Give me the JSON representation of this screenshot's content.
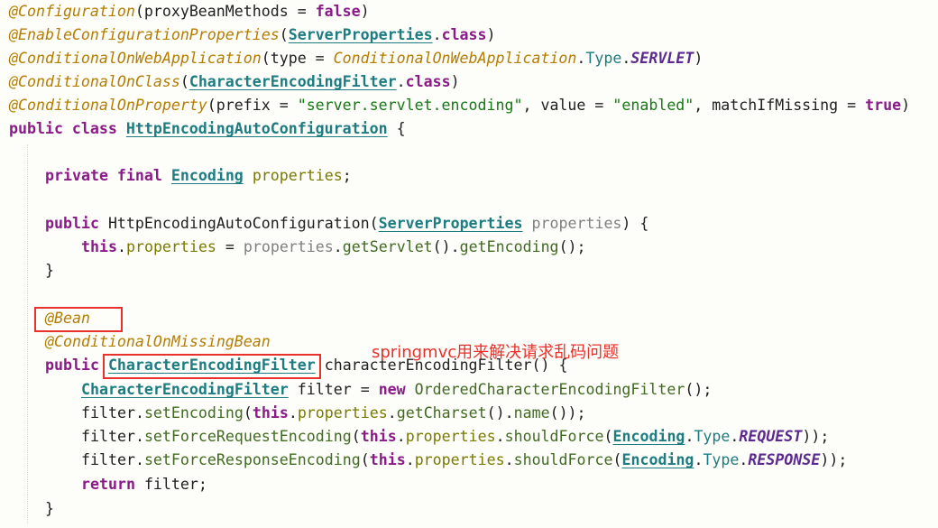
{
  "code": {
    "l1": [
      "@Configuration",
      "(proxyBeanMethods = ",
      "false",
      ")"
    ],
    "l2": [
      "@EnableConfigurationProperties",
      "(",
      "ServerProperties",
      ".",
      "class",
      ")"
    ],
    "l3": [
      "@ConditionalOnWebApplication",
      "(type = ",
      "ConditionalOnWebApplication",
      ".",
      "Type",
      ".",
      "SERVLET",
      ")"
    ],
    "l4": [
      "@ConditionalOnClass",
      "(",
      "CharacterEncodingFilter",
      ".",
      "class",
      ")"
    ],
    "l5": [
      "@ConditionalOnProperty",
      "(prefix = ",
      "\"server.servlet.encoding\"",
      ", value = ",
      "\"enabled\"",
      ", matchIfMissing = ",
      "true",
      ")"
    ],
    "l6": [
      "public class ",
      "HttpEncodingAutoConfiguration",
      " {"
    ],
    "l8": [
      "private final ",
      "Encoding",
      " ",
      "properties",
      ";"
    ],
    "l10": [
      "public ",
      "HttpEncodingAutoConfiguration(",
      "ServerProperties",
      " ",
      "properties",
      ") {"
    ],
    "l11": [
      "this",
      ".",
      "properties",
      " = ",
      "properties",
      ".",
      "getServlet",
      "().",
      "getEncoding",
      "();"
    ],
    "l12": [
      "}"
    ],
    "l14": [
      "@Bean"
    ],
    "l15": [
      "@ConditionalOnMissingBean"
    ],
    "l16": [
      "public ",
      "CharacterEncodingFilter",
      " characterEncodingFilter() {"
    ],
    "l17": [
      "CharacterEncodingFilter",
      " filter = ",
      "new ",
      "OrderedCharacterEncodingFilter",
      "();"
    ],
    "l18": [
      "filter.",
      "setEncoding",
      "(",
      "this",
      ".",
      "properties",
      ".",
      "getCharset",
      "().",
      "name",
      "());"
    ],
    "l19": [
      "filter.",
      "setForceRequestEncoding",
      "(",
      "this",
      ".",
      "properties",
      ".",
      "shouldForce",
      "(",
      "Encoding",
      ".",
      "Type",
      ".",
      "REQUEST",
      "));"
    ],
    "l20": [
      "filter.",
      "setForceResponseEncoding",
      "(",
      "this",
      ".",
      "properties",
      ".",
      "shouldForce",
      "(",
      "Encoding",
      ".",
      "Type",
      ".",
      "RESPONSE",
      "));"
    ],
    "l21": [
      "return ",
      "filter;"
    ],
    "l22": [
      "}"
    ]
  },
  "annotation_note": "springmvc用来解决请求乱码问题",
  "colors": {
    "highlight_box": "#e8312b",
    "annotation": "#b57d00",
    "keyword": "#8b1a89",
    "type": "#1c7c82",
    "string": "#147a14"
  }
}
